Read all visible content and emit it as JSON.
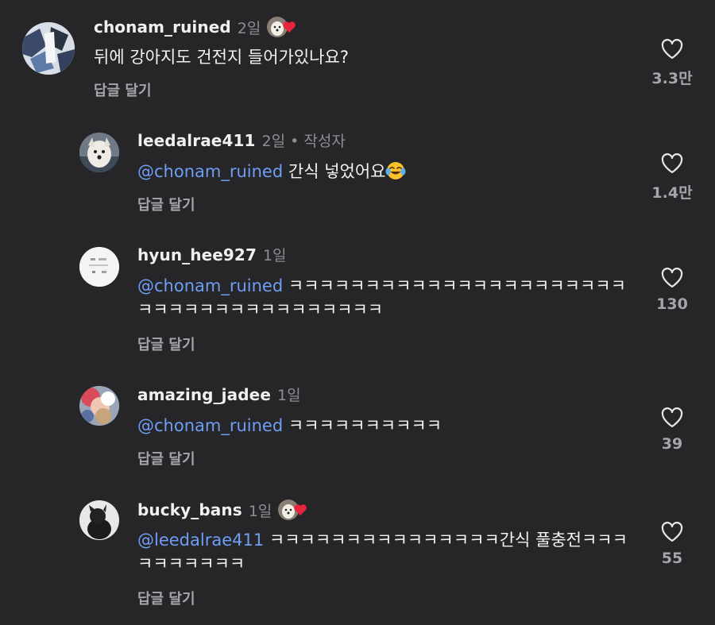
{
  "comments": [
    {
      "username": "chonam_ruined",
      "time": "2일",
      "text": "뒤에 강아지도 건전지 들어가있나요?",
      "reply": "답글 달기",
      "likes": "3.3만",
      "liked_by_creator": true
    },
    {
      "username": "leedalrae411",
      "time": "2일",
      "author_tag": "• 작성자",
      "mention": "@chonam_ruined",
      "text": "간식 넣었어요",
      "emoji": "face-with-tears-of-joy",
      "reply": "답글 달기",
      "likes": "1.4만"
    },
    {
      "username": "hyun_hee927",
      "time": "1일",
      "mention": "@chonam_ruined",
      "text": "ㅋㅋㅋㅋㅋㅋㅋㅋㅋㅋㅋㅋㅋㅋㅋㅋㅋㅋㅋㅋㅋㅋㅋㅋㅋㅋㅋㅋㅋㅋㅋㅋㅋㅋㅋㅋㅋㅋ",
      "reply": "답글 달기",
      "likes": "130"
    },
    {
      "username": "amazing_jadee",
      "time": "1일",
      "mention": "@chonam_ruined",
      "text": "ㅋㅋㅋㅋㅋㅋㅋㅋㅋㅋ",
      "reply": "답글 달기",
      "likes": "39"
    },
    {
      "username": "bucky_bans",
      "time": "1일",
      "mention": "@leedalrae411",
      "text": "ㅋㅋㅋㅋㅋㅋㅋㅋㅋㅋㅋㅋㅋㅋㅋ간식 풀충전ㅋㅋㅋㅋㅋㅋㅋㅋㅋㅋ",
      "reply": "답글 달기",
      "likes": "55",
      "liked_by_creator": true
    }
  ],
  "icons": {
    "like": "heart-outline-icon",
    "creator_like": "creator-liked-heart-icon",
    "emoji": "face-with-tears-of-joy"
  },
  "colors": {
    "background": "#262628",
    "mention": "#6e9ef5",
    "secondary_text": "#8d8d92",
    "creator_heart": "#e8243c"
  }
}
